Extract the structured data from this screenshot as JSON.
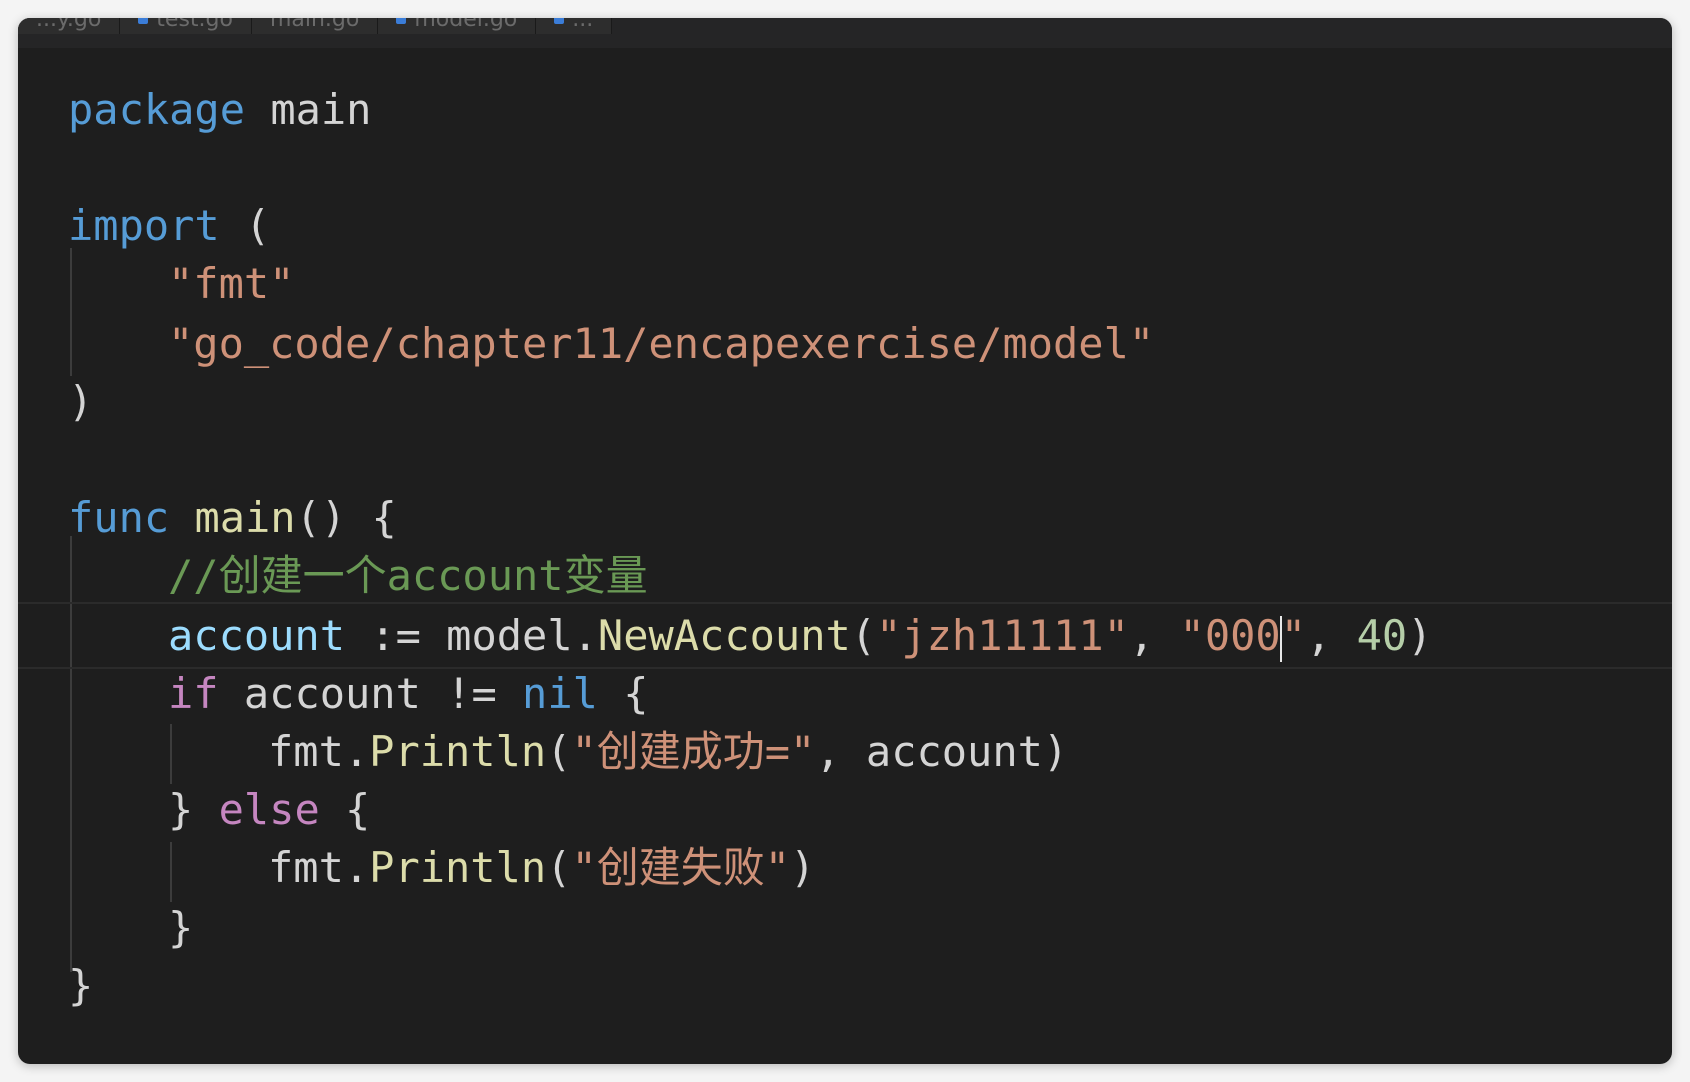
{
  "tabs": [
    {
      "label": "...y.go"
    },
    {
      "label": "test.go"
    },
    {
      "label": "main.go"
    },
    {
      "label": "model.go"
    },
    {
      "label": "..."
    }
  ],
  "code": {
    "l1": {
      "kw": "package",
      "sp": " ",
      "name": "main"
    },
    "l3": {
      "kw": "import",
      "sp": " ",
      "paren": "("
    },
    "l4": {
      "str": "\"fmt\""
    },
    "l5": {
      "str": "\"go_code/chapter11/encapexercise/model\""
    },
    "l6": {
      "paren": ")"
    },
    "l8": {
      "kw": "func",
      "sp": " ",
      "fn": "main",
      "rest": "() {"
    },
    "l9": {
      "comment": "//创建一个account变量"
    },
    "l10": {
      "var": "account",
      "op": " := ",
      "pkg": "model",
      "dot": ".",
      "fn": "NewAccount",
      "open": "(",
      "arg1": "\"jzh11111\"",
      "comma1": ", ",
      "arg2a": "\"000",
      "arg2b": "\"",
      "comma2": ", ",
      "arg3": "40",
      "close": ")"
    },
    "l11": {
      "kw": "if",
      "sp": " ",
      "var": "account",
      "op": " != ",
      "nil": "nil",
      "brace": " {"
    },
    "l12": {
      "pkg": "fmt",
      "dot": ".",
      "fn": "Println",
      "open": "(",
      "str": "\"创建成功=\"",
      "comma": ", ",
      "var": "account",
      "close": ")"
    },
    "l13": {
      "brace1": "}",
      "sp": " ",
      "kw": "else",
      "brace2": " {"
    },
    "l14": {
      "pkg": "fmt",
      "dot": ".",
      "fn": "Println",
      "open": "(",
      "str": "\"创建失败\"",
      "close": ")"
    },
    "l15": {
      "brace": "}"
    },
    "l16": {
      "brace": "}"
    }
  }
}
